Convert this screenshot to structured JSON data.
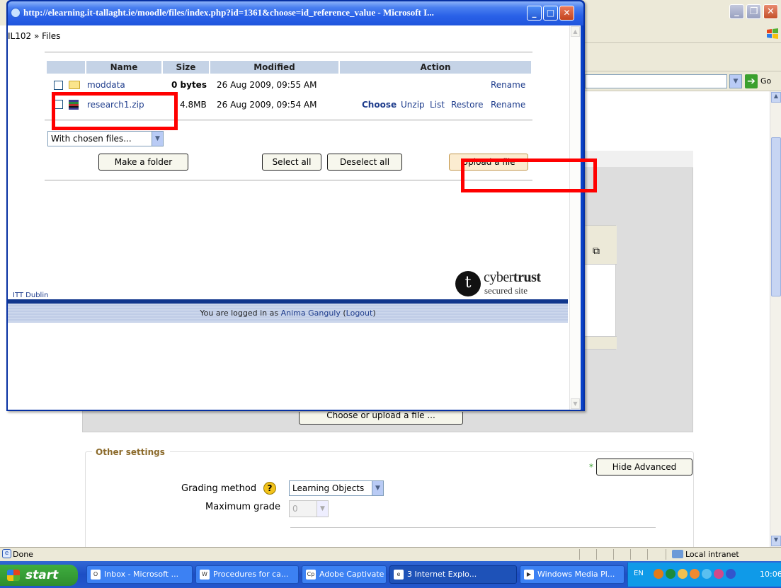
{
  "popup": {
    "title": "http://elearning.it-tallaght.ie/moodle/files/index.php?id=1361&choose=id_reference_value - Microsoft I...",
    "breadcrumb": "IL102 » Files",
    "table": {
      "headers": [
        "Name",
        "Size",
        "Modified",
        "Action"
      ],
      "rows": [
        {
          "name": "moddata",
          "size": "0 bytes",
          "modified": "26 Aug 2009, 09:55 AM",
          "actions": [
            "Rename"
          ]
        },
        {
          "name": "research1.zip",
          "size": "4.8MB",
          "modified": "26 Aug 2009, 09:54 AM",
          "actions": [
            "Choose",
            "Unzip",
            "List",
            "Restore",
            "Rename"
          ]
        }
      ]
    },
    "with_chosen": "With chosen files...",
    "buttons": {
      "make_folder": "Make a folder",
      "select_all": "Select all",
      "deselect_all": "Deselect all",
      "upload": "Upload a file"
    },
    "footer": {
      "site_link": "ITT Dublin",
      "logged_in_prefix": "You are logged in as ",
      "user": "Anima Ganguly",
      "open_paren": " (",
      "logout": "Logout",
      "close_paren": ")"
    },
    "badge": {
      "logo_letter": "t",
      "name_light": "cyber",
      "name_bold": "trust",
      "sub": "secured site"
    }
  },
  "background": {
    "go_label": "Go",
    "choose_upload": "Choose or upload a file ...",
    "other_settings": "Other settings",
    "hide_advanced": "Hide Advanced",
    "required_star": "*",
    "grading_label": "Grading method",
    "grading_value": "Learning Objects",
    "max_grade_label": "Maximum grade",
    "max_grade_value": "0"
  },
  "statusbar": {
    "status": "Done",
    "zone": "Local intranet"
  },
  "taskbar": {
    "start": "start",
    "tasks": [
      "Inbox - Microsoft ...",
      "Procedures for ca...",
      "Adobe Captivate ...",
      "3 Internet Explo...",
      "Windows Media Pl..."
    ],
    "lang": "EN",
    "clock": "10:06"
  },
  "colors": {
    "highlight": "#ff0000",
    "link": "#1e3c8c",
    "titlebar": "#2a61e8"
  }
}
